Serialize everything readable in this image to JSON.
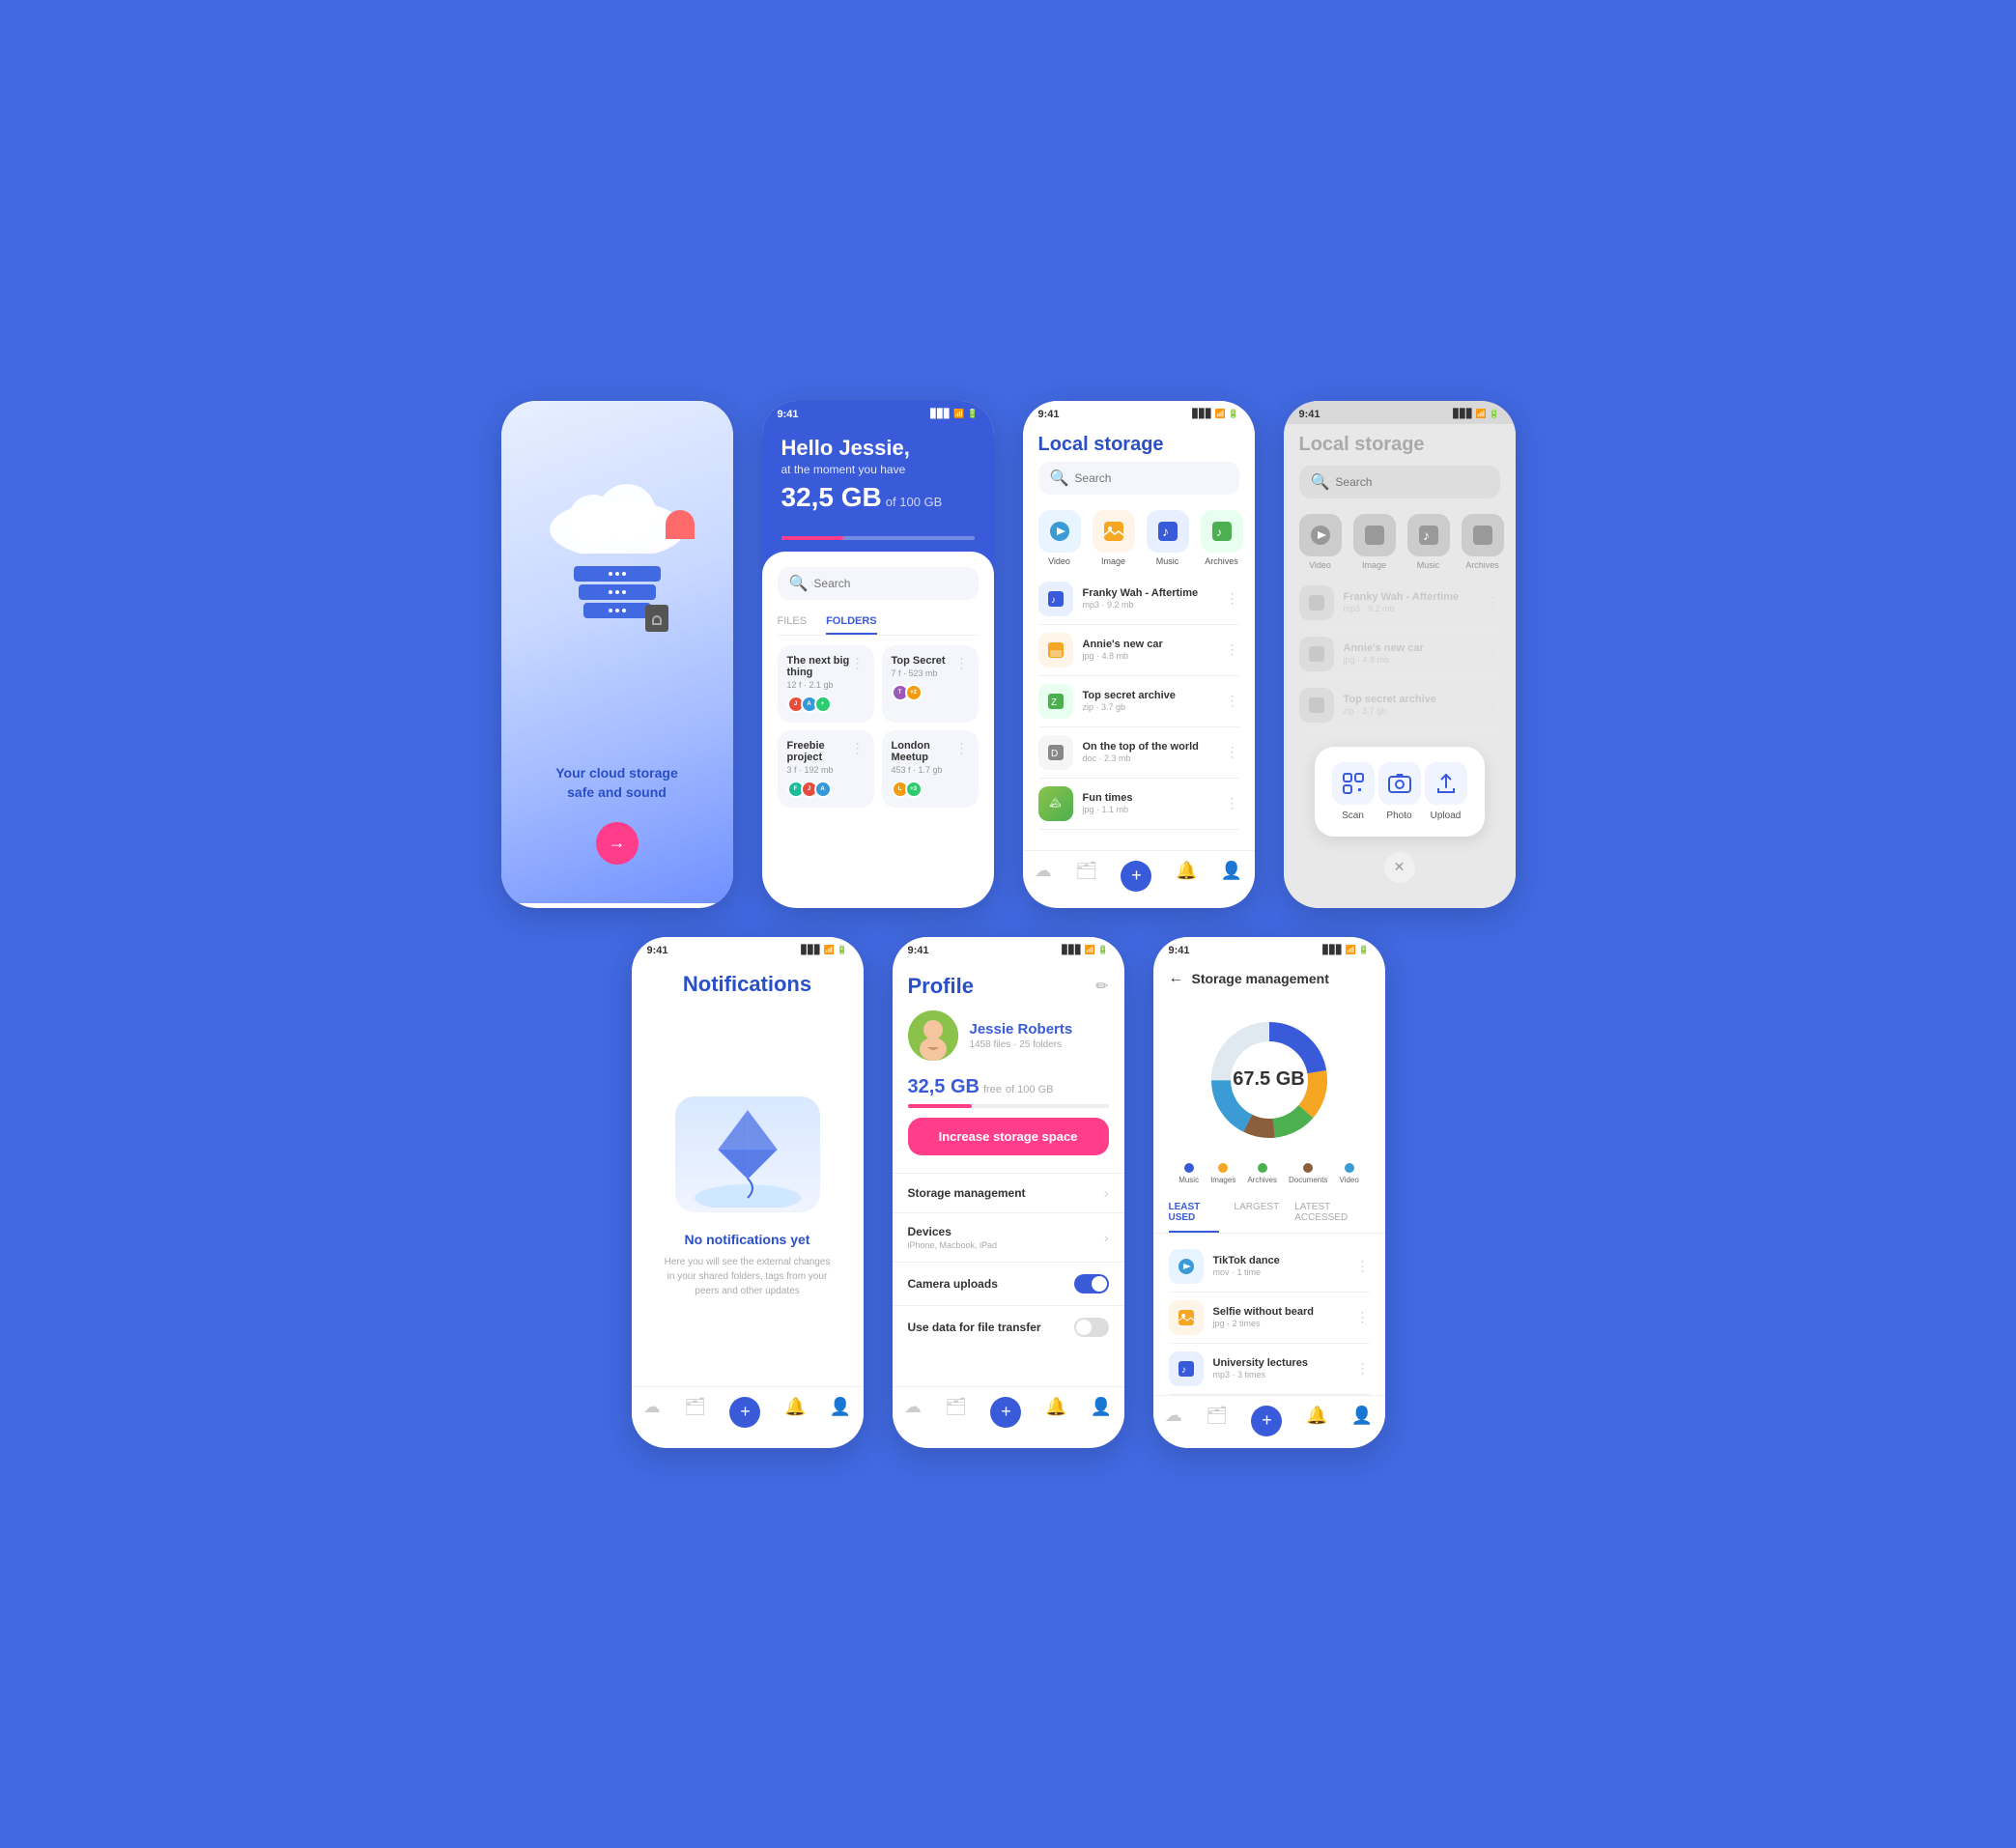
{
  "screen1": {
    "title_line1": "Your cloud storage",
    "title_line2": "safe and sound"
  },
  "screen2": {
    "status_time": "9:41",
    "greeting": "Hello Jessie,",
    "subtitle": "at the moment you have",
    "storage_used": "32,5 GB",
    "storage_total": "of 100 GB",
    "progress_pct": 32,
    "search_placeholder": "Search",
    "tab_files": "FILES",
    "tab_folders": "FOLDERS",
    "tab_active": "FOLDERS",
    "folders": [
      {
        "name": "The next big thing",
        "info": "12 f · 2.1 gb"
      },
      {
        "name": "Top Secret",
        "info": "7 f · 523 mb"
      },
      {
        "name": "Freebie project",
        "info": "3 f · 192 mb"
      },
      {
        "name": "London Meetup",
        "info": "453 f · 1.7 gb"
      }
    ]
  },
  "screen3": {
    "status_time": "9:41",
    "title": "Local storage",
    "search_placeholder": "Search",
    "categories": [
      {
        "name": "Video",
        "color": "#e8f4ff",
        "icon_color": "#3a9bd5"
      },
      {
        "name": "Image",
        "color": "#fff4e8",
        "icon_color": "#f5a623"
      },
      {
        "name": "Music",
        "color": "#e8f0ff",
        "icon_color": "#3a5bd9"
      },
      {
        "name": "Archives",
        "color": "#e8fff0",
        "icon_color": "#4CAF50"
      }
    ],
    "files": [
      {
        "name": "Franky Wah - Aftertime",
        "meta": "mp3 · 9.2 mb",
        "color": "#e8f0ff",
        "icon_color": "#3a5bd9"
      },
      {
        "name": "Annie's new car",
        "meta": "jpg · 4.8 mb",
        "color": "#fff4e8",
        "icon_color": "#f5a623"
      },
      {
        "name": "Top secret archive",
        "meta": "zip · 3.7 gb",
        "color": "#e8fff0",
        "icon_color": "#4CAF50"
      },
      {
        "name": "On the top of the world",
        "meta": "doc · 2.3 mb",
        "color": "#f5f5f5",
        "icon_color": "#888"
      },
      {
        "name": "Fun times",
        "meta": "jpg · 1.1 mb",
        "color": "#e8f4ff",
        "icon_color": "#3a9bd5"
      }
    ]
  },
  "screen4": {
    "status_time": "9:41",
    "title": "Local storage",
    "search_placeholder": "Search",
    "popup_actions": [
      {
        "name": "Scan",
        "icon": "⬜"
      },
      {
        "name": "Photo",
        "icon": "📷"
      },
      {
        "name": "Upload",
        "icon": "⬆"
      }
    ]
  },
  "screen5": {
    "status_time": "9:41",
    "title": "Notifications",
    "empty_title": "No notifications yet",
    "empty_desc": "Here you will see the external changes in your shared folders, tags from your peers and other updates"
  },
  "screen6": {
    "status_time": "9:41",
    "title": "Profile",
    "user_name": "Jessie Roberts",
    "user_stats": "1458 files · 25 folders",
    "storage_free": "32,5 GB",
    "storage_free_label": "free",
    "storage_total": "of 100 GB",
    "progress_pct": 32,
    "upgrade_btn": "Increase storage space",
    "menu_items": [
      {
        "label": "Storage management",
        "sub": "",
        "type": "chevron"
      },
      {
        "label": "Devices",
        "sub": "iPhone, Macbook, iPad",
        "type": "chevron"
      },
      {
        "label": "Camera uploads",
        "sub": "",
        "type": "toggle_on"
      },
      {
        "label": "Use data for file transfer",
        "sub": "",
        "type": "toggle_off"
      }
    ]
  },
  "screen7": {
    "status_time": "9:41",
    "back_label": "Storage management",
    "total_storage": "67.5 GB",
    "legend": [
      {
        "label": "Music",
        "color": "#3a5bd9"
      },
      {
        "label": "Images",
        "color": "#f5a623"
      },
      {
        "label": "Archives",
        "color": "#4CAF50"
      },
      {
        "label": "Documents",
        "color": "#8B5E3C"
      },
      {
        "label": "Video",
        "color": "#3a9bd5"
      }
    ],
    "sort_tabs": [
      {
        "label": "LEAST USED",
        "active": true
      },
      {
        "label": "LARGEST",
        "active": false
      },
      {
        "label": "LATEST ACCESSED",
        "active": false
      }
    ],
    "files": [
      {
        "name": "TikTok dance",
        "meta": "mov · 1 time",
        "color": "#e8f4ff",
        "icon_color": "#3a9bd5"
      },
      {
        "name": "Selfie without beard",
        "meta": "jpg · 2 times",
        "color": "#fff4e8",
        "icon_color": "#f5a623"
      },
      {
        "name": "University lectures",
        "meta": "mp3 · 3 times",
        "color": "#e8f0ff",
        "icon_color": "#3a5bd9"
      }
    ]
  }
}
